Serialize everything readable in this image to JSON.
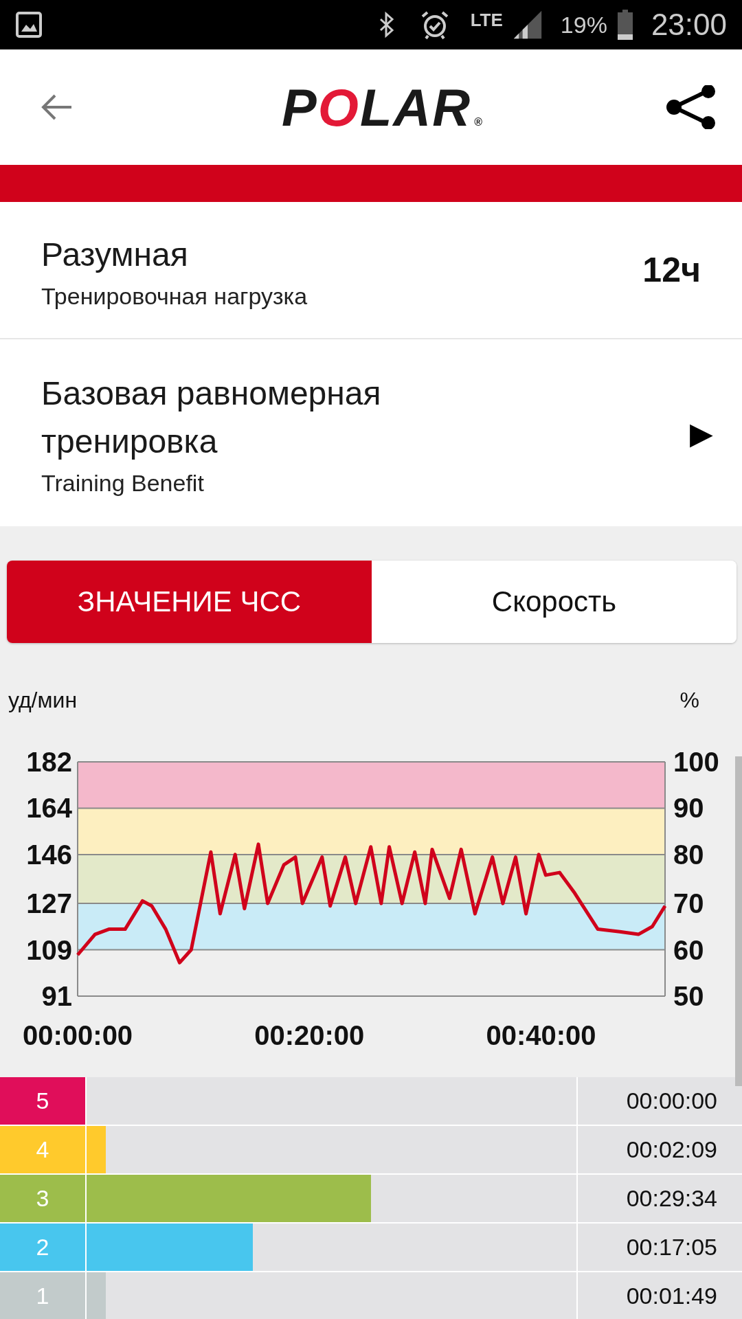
{
  "status_bar": {
    "network": "LTE",
    "battery": "19%",
    "time": "23:00"
  },
  "header": {
    "logo": "POLAR",
    "logo_mark": "®"
  },
  "load": {
    "title": "Разумная",
    "subtitle": "Тренировочная нагрузка",
    "value": "12ч"
  },
  "benefit": {
    "title": "Базовая равномерная тренировка",
    "subtitle": "Training Benefit",
    "arrow": "▶"
  },
  "tabs": [
    {
      "label": "ЗНАЧЕНИЕ ЧСС",
      "selected": true
    },
    {
      "label": "Скорость",
      "selected": false
    }
  ],
  "chart": {
    "right_axis": {
      "label": "%",
      "ticks": [
        "100",
        "90",
        "80",
        "70",
        "60",
        "50"
      ]
    },
    "chart_data": {
      "type": "line",
      "ylabel": "уд/мин",
      "xlim": [
        0,
        50.7
      ],
      "ylim": [
        91,
        182
      ],
      "xticks": [
        {
          "value": 0,
          "label": "00:00:00"
        },
        {
          "value": 20,
          "label": "00:20:00"
        },
        {
          "value": 40,
          "label": "00:40:00"
        }
      ],
      "yticks": [
        91,
        109,
        127,
        146,
        164,
        182
      ],
      "grid": true,
      "bands": [
        {
          "axis": "y",
          "from": 109,
          "to": 127,
          "color": "#c9ebf7"
        },
        {
          "axis": "y",
          "from": 127,
          "to": 146,
          "color": "#e3e9c9"
        },
        {
          "axis": "y",
          "from": 146,
          "to": 164,
          "color": "#fdefc0"
        },
        {
          "axis": "y",
          "from": 164,
          "to": 182,
          "color": "#f4b8cb"
        }
      ],
      "x": [
        0,
        1.5,
        2.7,
        4.1,
        5.6,
        6.4,
        7.6,
        8.8,
        9.8,
        11.5,
        12.3,
        13.6,
        14.4,
        15.6,
        16.4,
        17.8,
        18.8,
        19.4,
        21.1,
        21.8,
        23.1,
        24,
        25.3,
        26.2,
        26.9,
        28,
        29.1,
        30,
        30.6,
        32.1,
        33.1,
        34.3,
        35.8,
        36.7,
        37.8,
        38.7,
        39.8,
        40.4,
        41.6,
        42.9,
        44.9,
        46.8,
        48.4,
        49.6,
        50.7
      ],
      "series": [
        {
          "color": "#d0021b",
          "values": [
            107,
            115,
            117,
            117,
            128,
            126,
            117,
            104,
            109,
            147,
            123,
            146,
            125,
            150,
            127,
            142,
            145,
            127,
            145,
            126,
            145,
            127,
            149,
            127,
            149,
            127,
            147,
            127,
            148,
            129,
            148,
            123,
            145,
            127,
            145,
            123,
            146,
            138,
            139,
            131,
            117,
            116,
            115,
            118,
            126
          ]
        }
      ]
    }
  },
  "zones": [
    {
      "label": "5",
      "color": "#e00e5a",
      "time": "00:00:00"
    },
    {
      "label": "4",
      "color": "#ffca2c",
      "level": 0.039,
      "time": "00:02:09"
    },
    {
      "label": "3",
      "color": "#9dbd4b",
      "level": 0.58,
      "time": "00:29:34"
    },
    {
      "label": "2",
      "color": "#48c6ee",
      "level": 0.339,
      "time": "00:17:05"
    },
    {
      "label": "1",
      "color": "#c2cbcb",
      "level": 0.039,
      "time": "00:01:49"
    }
  ]
}
